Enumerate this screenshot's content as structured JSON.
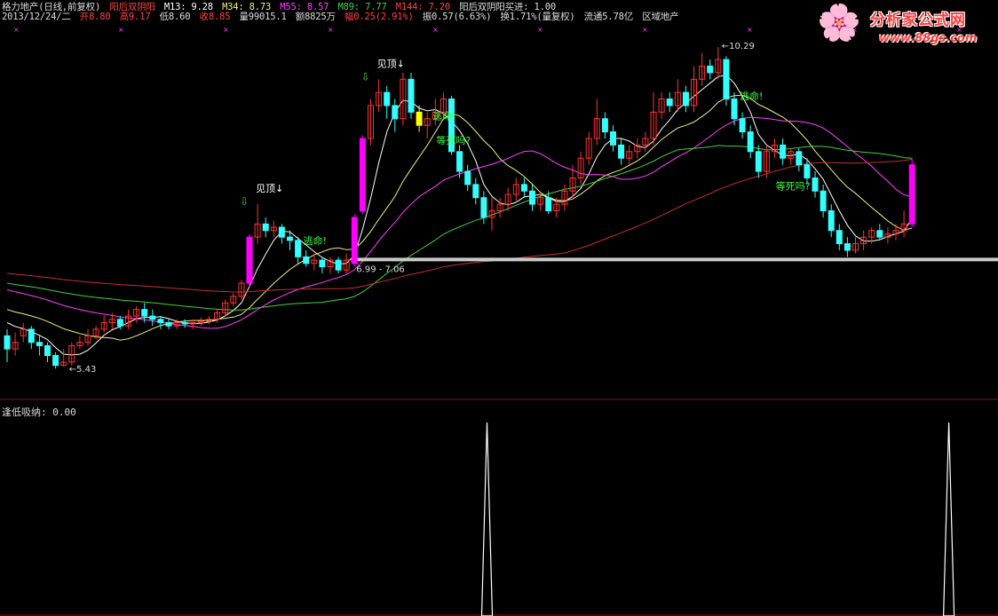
{
  "header": {
    "stock": "格力地产(日线,前复权)",
    "indicator_name": "阳后双阴阳",
    "ma13": "M13: 9.28",
    "ma34": "M34: 8.73",
    "ma55": "M55: 8.57",
    "ma89": "M89: 7.77",
    "ma144": "M144: 7.20",
    "signal": "阳后双阴阳买进: 1.00",
    "date": "2013/12/24/二",
    "open": "开8.80",
    "high": "高9.17",
    "low": "低8.60",
    "close": "收8.85",
    "volume": "量99015.1",
    "amount": "额8825万",
    "change": "幅0.25(2.91%)",
    "amplitude": "振0.57(6.63%)",
    "turnover": "换1.71%(量复权)",
    "float": "流通5.78亿",
    "sector": "区域地产"
  },
  "sub_panel": {
    "label": "逢低吸纳: 0.00"
  },
  "logo": {
    "title": "分析家公式网",
    "url": "www.88gs.com"
  },
  "colors": {
    "up": "#ff3333",
    "down": "#33ffff",
    "ma13": "#ffffff",
    "ma34": "#f2f27a",
    "ma55": "#ff40ff",
    "ma89": "#40d040",
    "ma144": "#c03030",
    "signal_bar": "#ff00ff",
    "yellow_bar": "#ffff00",
    "support": "#c8c8c8"
  },
  "chart_data": {
    "type": "candlestick",
    "price_range": [
      5.0,
      10.6
    ],
    "candles": [
      [
        0,
        5.9,
        5.7,
        6.0,
        5.5
      ],
      [
        1,
        5.7,
        5.8,
        5.95,
        5.6
      ],
      [
        2,
        5.9,
        6.0,
        6.1,
        5.8
      ],
      [
        3,
        6.0,
        5.8,
        6.05,
        5.7
      ],
      [
        4,
        5.8,
        5.75,
        5.9,
        5.6
      ],
      [
        5,
        5.75,
        5.6,
        5.8,
        5.5
      ],
      [
        6,
        5.6,
        5.45,
        5.65,
        5.4
      ],
      [
        7,
        5.45,
        5.5,
        5.7,
        5.43
      ],
      [
        8,
        5.5,
        5.75,
        5.8,
        5.45
      ],
      [
        9,
        5.75,
        5.8,
        5.9,
        5.7
      ],
      [
        10,
        5.8,
        5.9,
        6.0,
        5.75
      ],
      [
        11,
        5.9,
        6.0,
        6.05,
        5.85
      ],
      [
        12,
        6.0,
        6.1,
        6.2,
        5.95
      ],
      [
        13,
        6.1,
        6.15,
        6.25,
        6.0
      ],
      [
        14,
        6.15,
        6.05,
        6.2,
        6.0
      ],
      [
        15,
        6.05,
        6.2,
        6.3,
        6.0
      ],
      [
        16,
        6.2,
        6.3,
        6.35,
        6.1
      ],
      [
        17,
        6.3,
        6.2,
        6.4,
        6.1
      ],
      [
        18,
        6.2,
        6.15,
        6.3,
        6.05
      ],
      [
        19,
        6.15,
        6.1,
        6.2,
        6.0
      ],
      [
        20,
        6.1,
        6.05,
        6.15,
        6.0
      ],
      [
        21,
        6.05,
        6.1,
        6.15,
        6.0
      ],
      [
        22,
        6.1,
        6.08,
        6.15,
        6.02
      ],
      [
        23,
        6.08,
        6.1,
        6.15,
        6.0
      ],
      [
        24,
        6.1,
        6.12,
        6.18,
        6.05
      ],
      [
        25,
        6.12,
        6.15,
        6.2,
        6.08
      ],
      [
        26,
        6.15,
        6.25,
        6.3,
        6.1
      ],
      [
        27,
        6.25,
        6.4,
        6.45,
        6.2
      ],
      [
        28,
        6.4,
        6.5,
        6.55,
        6.35
      ],
      [
        29,
        6.5,
        6.7,
        6.75,
        6.45
      ],
      [
        30,
        6.7,
        7.4,
        7.45,
        6.65
      ],
      [
        31,
        7.4,
        7.6,
        7.9,
        7.3
      ],
      [
        32,
        7.6,
        7.5,
        7.7,
        7.4
      ],
      [
        33,
        7.5,
        7.55,
        7.65,
        7.4
      ],
      [
        34,
        7.55,
        7.4,
        7.6,
        7.3
      ],
      [
        35,
        7.4,
        7.35,
        7.5,
        7.2
      ],
      [
        36,
        7.35,
        7.1,
        7.4,
        7.0
      ],
      [
        37,
        7.1,
        7.0,
        7.2,
        6.95
      ],
      [
        38,
        7.0,
        7.05,
        7.15,
        6.9
      ],
      [
        39,
        7.05,
        6.95,
        7.1,
        6.85
      ],
      [
        40,
        6.95,
        7.05,
        7.1,
        6.85
      ],
      [
        41,
        7.05,
        6.9,
        7.1,
        6.85
      ],
      [
        42,
        6.9,
        7.05,
        7.15,
        6.85
      ],
      [
        43,
        7.0,
        7.7,
        7.75,
        6.95
      ],
      [
        44,
        7.8,
        8.9,
        8.95,
        7.75
      ],
      [
        45,
        8.9,
        9.4,
        9.5,
        8.8
      ],
      [
        46,
        9.4,
        9.6,
        9.8,
        9.3
      ],
      [
        47,
        9.6,
        9.4,
        9.7,
        9.2
      ],
      [
        48,
        9.4,
        9.2,
        9.5,
        9.0
      ],
      [
        49,
        9.2,
        9.8,
        9.9,
        9.1
      ],
      [
        50,
        9.8,
        9.3,
        9.9,
        9.2
      ],
      [
        51,
        9.3,
        9.1,
        9.4,
        9.0
      ],
      [
        52,
        9.1,
        9.2,
        9.3,
        8.9
      ],
      [
        53,
        9.2,
        9.3,
        9.5,
        9.1
      ],
      [
        54,
        9.3,
        9.5,
        9.6,
        9.2
      ],
      [
        55,
        9.5,
        8.7,
        9.55,
        8.65
      ],
      [
        56,
        8.7,
        8.4,
        8.8,
        8.3
      ],
      [
        57,
        8.4,
        8.2,
        8.5,
        8.1
      ],
      [
        58,
        8.2,
        8.0,
        8.3,
        7.9
      ],
      [
        59,
        8.0,
        7.7,
        8.1,
        7.6
      ],
      [
        60,
        7.7,
        7.8,
        8.0,
        7.5
      ],
      [
        61,
        7.8,
        7.9,
        8.0,
        7.7
      ],
      [
        62,
        7.9,
        8.05,
        8.15,
        7.8
      ],
      [
        63,
        8.05,
        8.2,
        8.3,
        7.95
      ],
      [
        64,
        8.2,
        8.1,
        8.3,
        8.0
      ],
      [
        65,
        8.1,
        7.9,
        8.2,
        7.8
      ],
      [
        66,
        7.9,
        8.0,
        8.05,
        7.8
      ],
      [
        67,
        8.0,
        7.8,
        8.1,
        7.75
      ],
      [
        68,
        7.8,
        7.9,
        8.0,
        7.7
      ],
      [
        69,
        7.9,
        8.1,
        8.2,
        7.8
      ],
      [
        70,
        8.1,
        8.3,
        8.5,
        8.0
      ],
      [
        71,
        8.3,
        8.6,
        8.7,
        8.2
      ],
      [
        72,
        8.6,
        8.9,
        9.0,
        8.5
      ],
      [
        73,
        8.9,
        9.2,
        9.5,
        8.8
      ],
      [
        74,
        9.2,
        9.0,
        9.3,
        8.9
      ],
      [
        75,
        9.0,
        8.8,
        9.1,
        8.7
      ],
      [
        76,
        8.8,
        8.6,
        8.9,
        8.5
      ],
      [
        77,
        8.6,
        8.7,
        8.8,
        8.5
      ],
      [
        78,
        8.7,
        8.8,
        8.9,
        8.6
      ],
      [
        79,
        8.8,
        8.9,
        9.0,
        8.7
      ],
      [
        80,
        8.9,
        9.3,
        9.6,
        8.8
      ],
      [
        81,
        9.3,
        9.5,
        9.6,
        9.2
      ],
      [
        82,
        9.5,
        9.4,
        9.6,
        9.3
      ],
      [
        83,
        9.4,
        9.6,
        9.8,
        9.3
      ],
      [
        84,
        9.6,
        9.4,
        9.7,
        9.3
      ],
      [
        85,
        9.4,
        9.8,
        10.0,
        9.3
      ],
      [
        86,
        9.8,
        10.0,
        10.2,
        9.7
      ],
      [
        87,
        10.0,
        9.9,
        10.1,
        9.8
      ],
      [
        88,
        9.9,
        10.1,
        10.29,
        9.8
      ],
      [
        89,
        10.1,
        9.5,
        10.15,
        9.4
      ],
      [
        90,
        9.5,
        9.2,
        9.6,
        9.1
      ],
      [
        91,
        9.2,
        9.0,
        9.3,
        8.9
      ],
      [
        92,
        9.0,
        8.7,
        9.1,
        8.6
      ],
      [
        93,
        8.7,
        8.4,
        8.8,
        8.3
      ],
      [
        94,
        8.4,
        8.7,
        8.8,
        8.3
      ],
      [
        95,
        8.7,
        8.8,
        8.9,
        8.6
      ],
      [
        96,
        8.8,
        8.6,
        8.9,
        8.5
      ],
      [
        97,
        8.6,
        8.7,
        8.75,
        8.5
      ],
      [
        98,
        8.7,
        8.5,
        8.75,
        8.4
      ],
      [
        99,
        8.5,
        8.3,
        8.6,
        8.2
      ],
      [
        100,
        8.3,
        8.1,
        8.4,
        8.0
      ],
      [
        101,
        8.1,
        7.8,
        8.2,
        7.7
      ],
      [
        102,
        7.8,
        7.5,
        7.9,
        7.4
      ],
      [
        103,
        7.5,
        7.3,
        7.6,
        7.2
      ],
      [
        104,
        7.3,
        7.2,
        7.4,
        7.1
      ],
      [
        105,
        7.2,
        7.3,
        7.4,
        7.15
      ],
      [
        106,
        7.3,
        7.4,
        7.5,
        7.2
      ],
      [
        107,
        7.4,
        7.5,
        7.55,
        7.3
      ],
      [
        108,
        7.5,
        7.4,
        7.6,
        7.35
      ],
      [
        109,
        7.4,
        7.45,
        7.55,
        7.3
      ],
      [
        110,
        7.45,
        7.5,
        7.6,
        7.35
      ],
      [
        111,
        7.5,
        7.6,
        7.8,
        7.4
      ],
      [
        112,
        7.6,
        8.5,
        8.6,
        7.55
      ]
    ],
    "annotations": [
      {
        "bar": 7,
        "text": "5.43",
        "kind": "low"
      },
      {
        "bar": 88,
        "text": "10.29",
        "kind": "high"
      },
      {
        "bar": 31,
        "text": "见顶",
        "kind": "top"
      },
      {
        "bar": 46,
        "text": "见顶",
        "kind": "top"
      },
      {
        "bar": 36,
        "text": "逃命!",
        "kind": "escape"
      },
      {
        "bar": 52,
        "text": "逃命!",
        "kind": "escape"
      },
      {
        "bar": 90,
        "text": "逃命!",
        "kind": "escape"
      },
      {
        "bar": 54,
        "text": "等死吗?",
        "kind": "wait"
      },
      {
        "bar": 96,
        "text": "等死吗?",
        "kind": "wait"
      },
      {
        "bar": 43,
        "text": "6.99 - 7.06",
        "kind": "range"
      }
    ],
    "support_level": 7.06,
    "signal_bars": [
      30,
      43,
      44,
      112
    ],
    "yellow_bar": 51,
    "sub_peaks": [
      55,
      106
    ]
  }
}
